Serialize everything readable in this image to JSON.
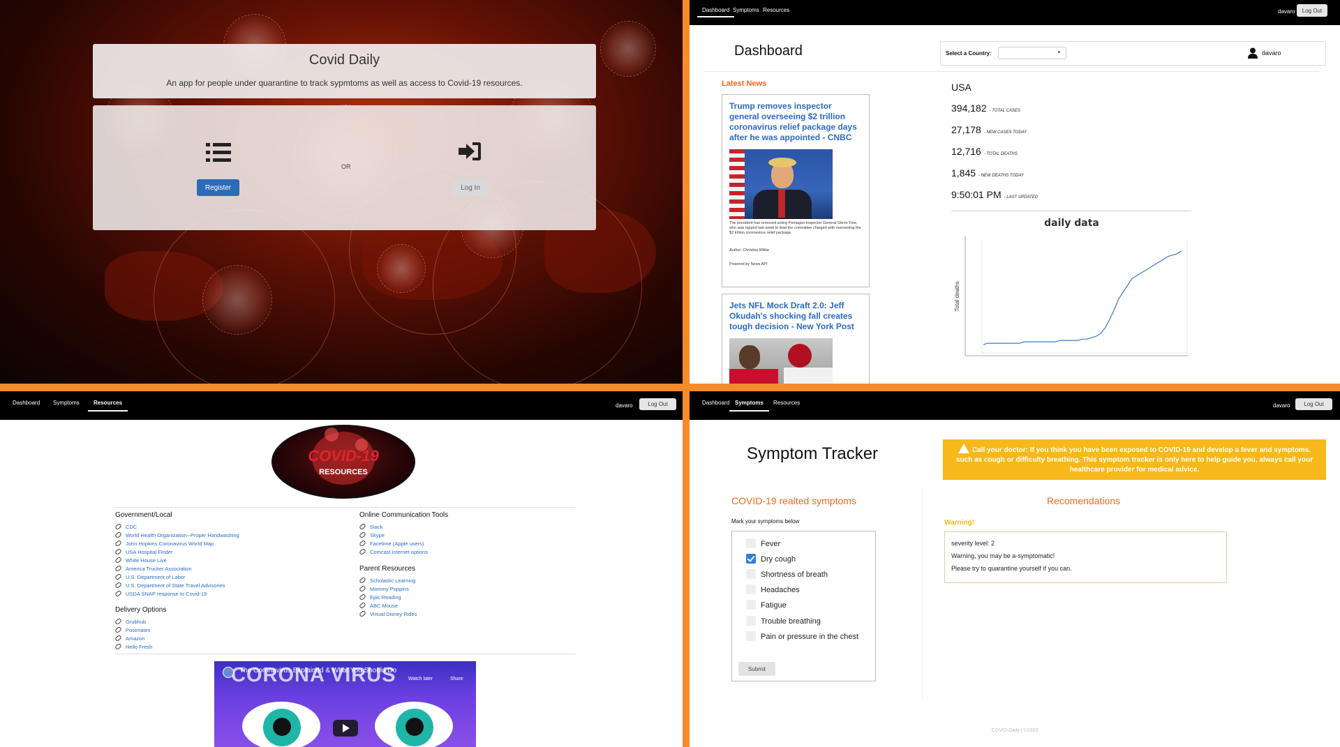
{
  "login": {
    "app_title": "Covid Daily",
    "tagline": "An app for people under quarantine to track sypmtoms as well as access to Covid-19 resources.",
    "register_label": "Register",
    "or_label": "OR",
    "login_label": "Log In"
  },
  "dashboard": {
    "nav": {
      "tabs": [
        "Dashboard",
        "Symptoms",
        "Resources"
      ],
      "active": "Dashboard",
      "user": "davaro",
      "logout_label": "Log Out"
    },
    "title": "Dashboard",
    "country_label": "Select a Country:",
    "country_value": "",
    "username": "davaro",
    "news_heading": "Latest News",
    "news": [
      {
        "headline": "Trump removes inspector general overseeing $2 trillion coronavirus relief package days after he was appointed - CNBC",
        "description": "The president has removed acting Pentagon Inspector General Glenn Fine, who was tapped last week to lead the committee charged with overseeing the $2 trillion coronavirus relief package.",
        "author": "Author: Christina Wilkie",
        "powered": "Powered by News API"
      },
      {
        "headline": "Jets NFL Mock Draft 2.0: Jeff Okudah's shocking fall creates tough decision - New York Post"
      }
    ],
    "stats": {
      "country": "USA",
      "rows": [
        {
          "value": "394,182",
          "label": "- TOTAL CASES"
        },
        {
          "value": "27,178",
          "label": "- NEW CASES TODAY"
        },
        {
          "value": "12,716",
          "label": "- TOTAL DEATHS"
        },
        {
          "value": "1,845",
          "label": "- NEW DEATHS TODAY"
        },
        {
          "value": "9:50:01 PM",
          "label": "- LAST UPDATED"
        }
      ]
    }
  },
  "chart_data": {
    "type": "line",
    "title": "daily data",
    "ylabel": "Total deaths",
    "xlabel": "",
    "grid": false,
    "legend": "none",
    "color": "#3a78c9",
    "series": [
      {
        "values": [
          2,
          3,
          3,
          3,
          3,
          3,
          3,
          3,
          3,
          4,
          4,
          4,
          4,
          4,
          4,
          4,
          4,
          5,
          5,
          5,
          5,
          5,
          6,
          6,
          7,
          8,
          10,
          14,
          20,
          27,
          35,
          40,
          45,
          50,
          52,
          54,
          56,
          58,
          60,
          62,
          64,
          66,
          67,
          68,
          70
        ]
      }
    ]
  },
  "resources": {
    "nav": {
      "tabs": [
        "Dashboard",
        "Symptoms",
        "Resources"
      ],
      "active": "Resources",
      "user": "davaro",
      "logout_label": "Log Out"
    },
    "logo_main": "COVID-19",
    "logo_sub": "RESOURCES",
    "sections": [
      {
        "title": "Government/Local",
        "links": [
          "CDC",
          "World Health Organization--Proper Handwashing",
          "John Hopkins Coronavirus World Map",
          "USA Hospital Finder",
          "White House Live",
          "America Trucker Association",
          "U.S. Department of Labor",
          "U.S. Department of State Travel Advisories",
          "USDA SNAP response to Covid-19"
        ]
      },
      {
        "title": "Delivery Options",
        "links": [
          "Grubhub",
          "Postmates",
          "Amazon",
          "Hello Fresh"
        ]
      },
      {
        "title": "Online Communication Tools",
        "links": [
          "Slack",
          "Skype",
          "Facetime (Apple users)",
          "Comcast internet options"
        ]
      },
      {
        "title": "Parent Resources",
        "links": [
          "Scholastic Learning",
          "Mommy Poppins",
          "Epic Reading",
          "ABC Mouse",
          "Virtual Disney Rides"
        ]
      }
    ],
    "video": {
      "title": "The Coronavirus Explained & What You Should Do",
      "overlay": "CORONA VIRUS",
      "watch_later": "Watch later",
      "share": "Share"
    }
  },
  "symptoms": {
    "nav": {
      "tabs": [
        "Dashboard",
        "Symptoms",
        "Resources"
      ],
      "active": "Symptoms",
      "user": "davaro",
      "logout_label": "Log Out"
    },
    "title": "Symptom Tracker",
    "alert": "Call your doctor: If you think you have been exposed to COVID-19 and develop a fever and symptoms, such as cough or difficulty breathing. This symptom tracker is only here to help guide you, always call your healthcare provider for medical advice.",
    "left_title": "COVID-19 realted symptoms",
    "mark_label": "Mark your symptoms below",
    "items": [
      {
        "label": "Fever",
        "checked": false
      },
      {
        "label": "Dry cough",
        "checked": true
      },
      {
        "label": "Shortness of breath",
        "checked": false
      },
      {
        "label": "Headaches",
        "checked": false
      },
      {
        "label": "Fatigue",
        "checked": false
      },
      {
        "label": "Trouble breathing",
        "checked": false
      },
      {
        "label": "Pain or pressure in the chest",
        "checked": false
      }
    ],
    "submit_label": "Submit",
    "right_title": "Recomendations",
    "warning_label": "Warning!",
    "rec_lines": [
      "severity level: 2",
      "Warning, you may be a-symptomatic!",
      "Please try to quarantine yourself if you can."
    ],
    "footer": "COVID-Daily | ©2020"
  }
}
